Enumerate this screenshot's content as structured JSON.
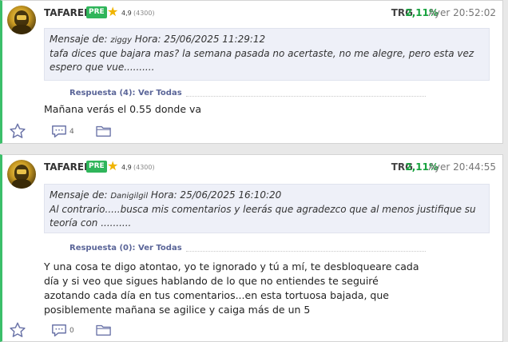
{
  "posts": [
    {
      "username": "TAFAREL",
      "badge": "PRE",
      "rating": "4,9",
      "rating_count": "(4300)",
      "ticker": "TRG",
      "change": "2,11%",
      "timestamp": "Ayer 20:52:02",
      "quote_prefix": "Mensaje de: ",
      "quote_author": "ziggy",
      "quote_time": " Hora: 25/06/2025 11:29:12",
      "quote_text": "tafa dices que bajara mas? la semana pasada no acertaste, no me alegre, pero esta vez espero que vue..........",
      "reply_link": "Respuesta (4): Ver Todas",
      "message": "Mañana verás el 0.55 donde va",
      "comments_count": "4"
    },
    {
      "username": "TAFAREL",
      "badge": "PRE",
      "rating": "4,9",
      "rating_count": "(4300)",
      "ticker": "TRG",
      "change": "2,11%",
      "timestamp": "Ayer 20:44:55",
      "quote_prefix": "Mensaje de: ",
      "quote_author": "Danigilgil",
      "quote_time": " Hora: 25/06/2025 16:10:20",
      "quote_text": "Al contrario.....busca mis comentarios y leerás que agradezco que al menos justifique su teoría con ..........",
      "reply_link": "Respuesta (0): Ver Todas",
      "message": "Y una cosa te digo atontao, yo te ignorado y tú a mí, te desbloqueare cada día y si veo que sigues hablando de lo que no entiendes te seguiré azotando cada día en tus comentarios...en esta tortuosa bajada, que posiblemente mañana se agilice y caiga más de un 5",
      "comments_count": "0"
    }
  ],
  "colors": {
    "accent_green": "#3bbf6a",
    "change_green": "#17a23e",
    "reply_link": "#5a6598",
    "quote_bg": "#eef0f8"
  },
  "icons": [
    "favorite-star-icon",
    "comments-icon",
    "folder-icon",
    "rating-star-icon"
  ]
}
